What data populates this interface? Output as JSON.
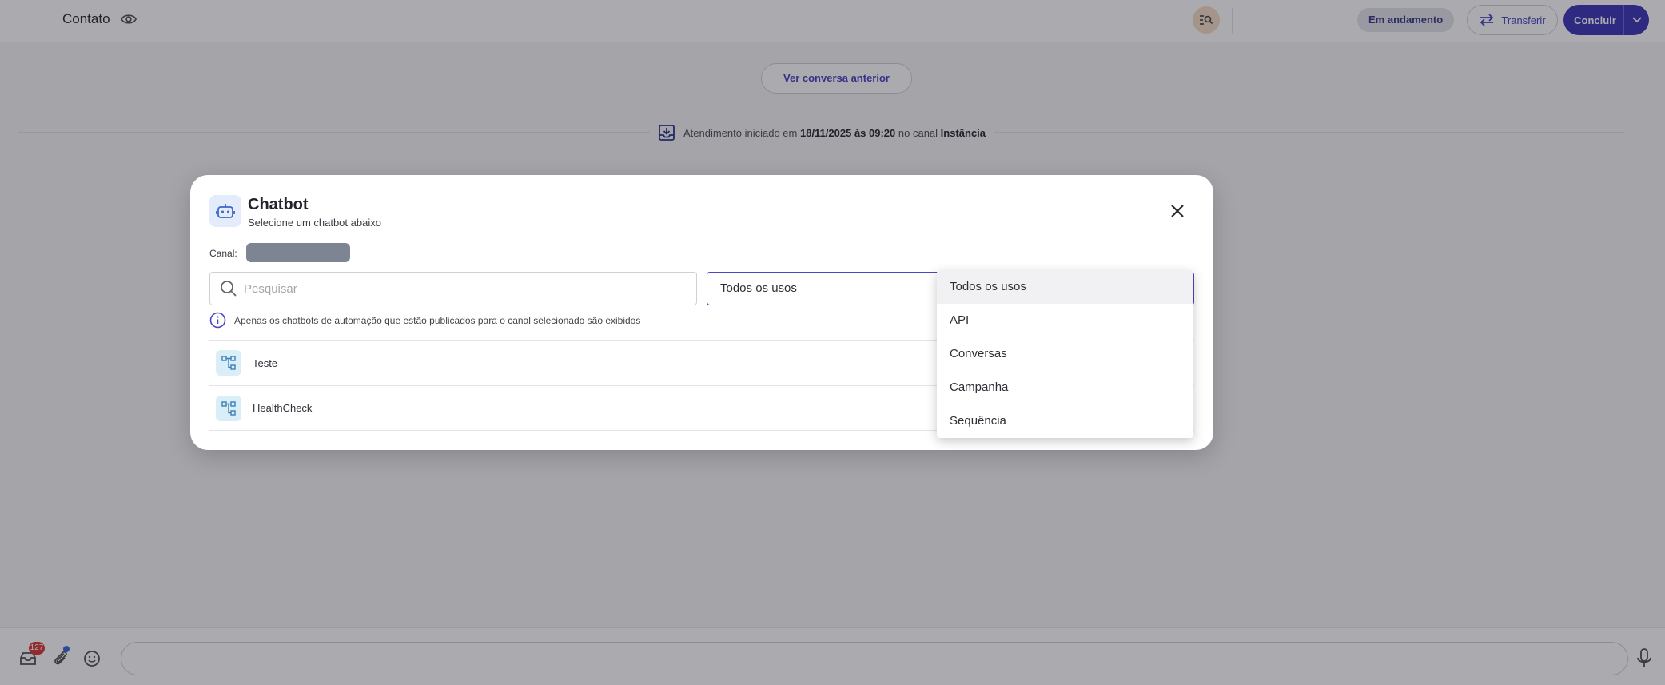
{
  "header": {
    "contact_title": "Contato",
    "status": "Em andamento",
    "transfer_label": "Transferir",
    "conclude_label": "Concluir"
  },
  "conversation": {
    "previous_button": "Ver conversa anterior",
    "session_prefix": "Atendimento iniciado em",
    "session_datetime": "18/11/2025 às 09:20",
    "session_channel_prefix": "no canal",
    "session_channel": "Instância"
  },
  "composer": {
    "notification_count": "127"
  },
  "modal": {
    "title": "Chatbot",
    "subtitle": "Selecione um chatbot abaixo",
    "channel_label": "Canal:",
    "search_placeholder": "Pesquisar",
    "selected_usage": "Todos os usos",
    "info_text": "Apenas os chatbots de automação que estão publicados para o canal selecionado são exibidos",
    "chatbots": [
      "Teste",
      "HealthCheck"
    ]
  },
  "dropdown": {
    "options": [
      "Todos os usos",
      "API",
      "Conversas",
      "Campanha",
      "Sequência"
    ],
    "selected_index": 0
  },
  "colors": {
    "primary": "#3f3ab8",
    "accent": "#4a47c4",
    "badge": "#d93a3a"
  }
}
